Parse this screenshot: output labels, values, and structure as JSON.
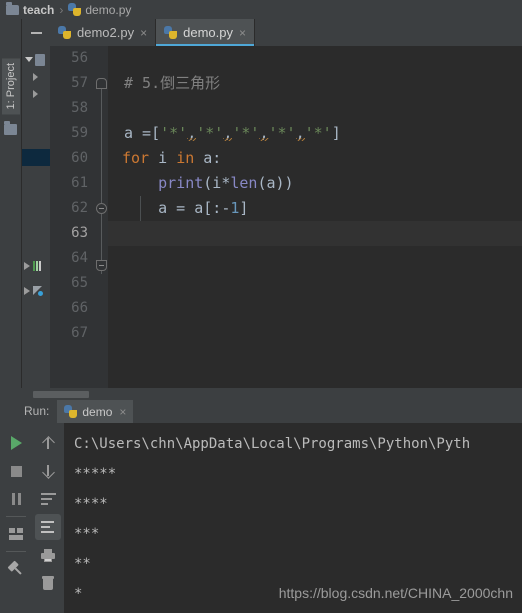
{
  "breadcrumb": {
    "folder_icon": "folder-icon",
    "folder": "teach",
    "separator": "›",
    "file_icon": "python-file-icon",
    "file": "demo.py"
  },
  "left_toolstrip": {
    "project_tab": "1: Project",
    "project_icon": "folder-icon"
  },
  "editor_tabs": [
    {
      "label": "demo2.py",
      "icon": "python-file-icon",
      "close": "×",
      "active": false
    },
    {
      "label": "demo.py",
      "icon": "python-file-icon",
      "close": "×",
      "active": true
    }
  ],
  "project_panel": {
    "collapse_label": "—"
  },
  "editor": {
    "first_line": 56,
    "current_line": 63,
    "lines": [
      {
        "no": "56",
        "tokens": []
      },
      {
        "no": "57",
        "tokens": [
          {
            "t": "# 5.倒三角形",
            "c": "cmt"
          }
        ]
      },
      {
        "no": "58",
        "tokens": []
      },
      {
        "no": "59",
        "tokens": [
          {
            "t": "a =",
            "c": "punct"
          },
          {
            "t": "[",
            "c": "br"
          },
          {
            "t": "'*'",
            "c": "str"
          },
          {
            "t": ",",
            "c": "sqc"
          },
          {
            "t": "'*'",
            "c": "str"
          },
          {
            "t": ",",
            "c": "sqc"
          },
          {
            "t": "'*'",
            "c": "str"
          },
          {
            "t": ",",
            "c": "sqc"
          },
          {
            "t": "'*'",
            "c": "str"
          },
          {
            "t": ",",
            "c": "sqc"
          },
          {
            "t": "'*'",
            "c": "str"
          },
          {
            "t": "]",
            "c": "br"
          }
        ]
      },
      {
        "no": "60",
        "tokens": [
          {
            "t": "for",
            "c": "kw"
          },
          {
            "t": " i ",
            "c": "punct"
          },
          {
            "t": "in",
            "c": "kw"
          },
          {
            "t": " a:",
            "c": "punct"
          }
        ]
      },
      {
        "no": "61",
        "tokens": [
          {
            "t": "    ",
            "c": "punct"
          },
          {
            "t": "print",
            "c": "fn"
          },
          {
            "t": "(i*",
            "c": "punct"
          },
          {
            "t": "len",
            "c": "fn"
          },
          {
            "t": "(a))",
            "c": "punct"
          }
        ]
      },
      {
        "no": "62",
        "tokens": [
          {
            "t": "    a = a[:-",
            "c": "punct"
          },
          {
            "t": "1",
            "c": "num"
          },
          {
            "t": "]",
            "c": "punct"
          }
        ]
      },
      {
        "no": "63",
        "tokens": []
      },
      {
        "no": "64",
        "tokens": []
      },
      {
        "no": "65",
        "tokens": []
      },
      {
        "no": "66",
        "tokens": []
      },
      {
        "no": "67",
        "tokens": []
      }
    ]
  },
  "run_panel": {
    "label": "Run:",
    "tab": {
      "label": "demo",
      "icon": "python-file-icon",
      "close": "×"
    },
    "left_tools": [
      {
        "name": "rerun-button",
        "icon": "play-icon"
      },
      {
        "name": "stop-button",
        "icon": "stop-icon"
      },
      {
        "name": "pause-button",
        "icon": "pause-icon"
      },
      {
        "name": "layout-button",
        "icon": "layout-icon"
      },
      {
        "name": "pin-tab-button",
        "icon": "pin-icon"
      }
    ],
    "right_tools": [
      {
        "name": "up-button",
        "icon": "arrow-up-icon"
      },
      {
        "name": "down-button",
        "icon": "arrow-down-icon"
      },
      {
        "name": "soft-wrap-button",
        "icon": "soft-wrap-icon"
      },
      {
        "name": "scroll-to-end-button",
        "icon": "scroll-to-end-icon"
      },
      {
        "name": "print-button",
        "icon": "print-icon"
      },
      {
        "name": "clear-all-button",
        "icon": "trash-icon"
      }
    ],
    "console_lines": [
      "C:\\Users\\chn\\AppData\\Local\\Programs\\Python\\Pyth",
      "*****",
      "****",
      "***",
      "**",
      "*"
    ],
    "watermark": "https://blog.csdn.net/CHINA_2000chn"
  },
  "colors": {
    "accent_tab_underline": "#4fa8d8",
    "run_green": "#59a869",
    "keyword": "#cc7832",
    "string": "#6a8759",
    "function": "#8888c6",
    "comment": "#808080",
    "number": "#6897bb",
    "editor_bg": "#2b2b2b",
    "panel_bg": "#3c3f41"
  }
}
